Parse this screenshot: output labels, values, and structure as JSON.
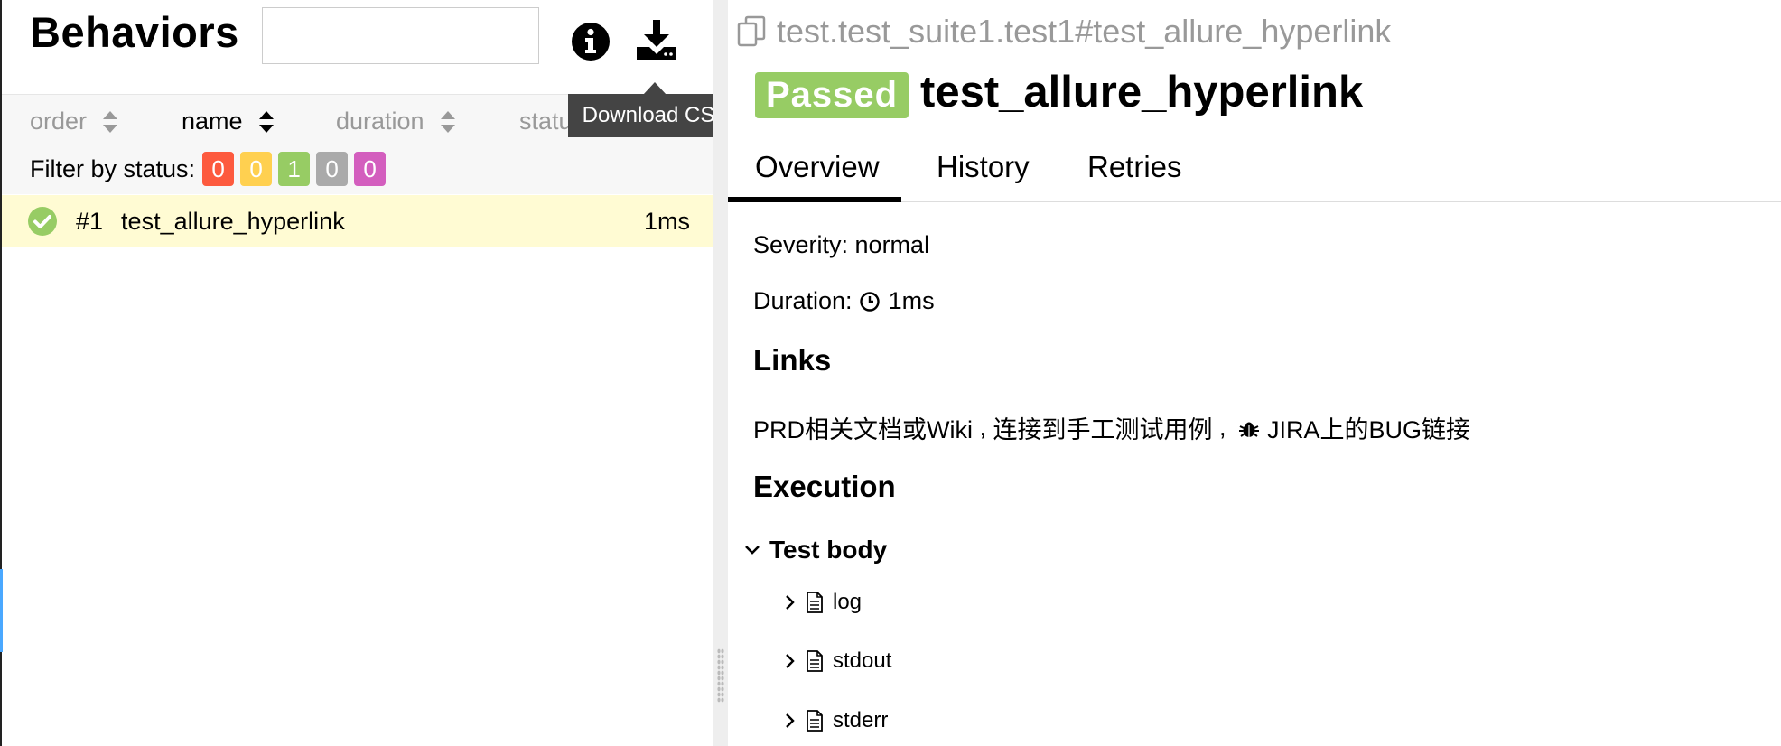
{
  "left": {
    "title": "Behaviors",
    "search": {
      "value": "",
      "placeholder": ""
    },
    "icons": {
      "info": "info-circle-icon",
      "download": "download-icon"
    },
    "tooltip": "Download CSV",
    "sort_columns": [
      {
        "label": "order",
        "active": false
      },
      {
        "label": "name",
        "active": true
      },
      {
        "label": "duration",
        "active": false
      },
      {
        "label": "status",
        "active": false
      }
    ],
    "filter": {
      "label": "Filter by status:",
      "chips": [
        {
          "count": "0",
          "status": "failed",
          "color": "#fd5a3e"
        },
        {
          "count": "0",
          "status": "broken",
          "color": "#ffd050"
        },
        {
          "count": "1",
          "status": "passed",
          "color": "#97cc64"
        },
        {
          "count": "0",
          "status": "skipped",
          "color": "#aaaaaa"
        },
        {
          "count": "0",
          "status": "unknown",
          "color": "#d35ebe"
        }
      ]
    },
    "tests": [
      {
        "order": "#1",
        "name": "test_allure_hyperlink",
        "duration": "1ms",
        "status": "passed"
      }
    ]
  },
  "right": {
    "breadcrumb": "test.test_suite1.test1#test_allure_hyperlink",
    "status_badge": "Passed",
    "title": "test_allure_hyperlink",
    "tabs": [
      {
        "label": "Overview",
        "active": true
      },
      {
        "label": "History",
        "active": false
      },
      {
        "label": "Retries",
        "active": false
      }
    ],
    "severity": "Severity: normal",
    "duration_label": "Duration:",
    "duration_value": "1ms",
    "links_heading": "Links",
    "links": {
      "link1": "PRD相关文档或Wiki",
      "sep1": " , ",
      "link2": "连接到手工测试用例",
      "sep2": " , ",
      "link3": "JIRA上的BUG链接"
    },
    "execution_heading": "Execution",
    "step": "Test body",
    "attachments": [
      "log",
      "stdout",
      "stderr"
    ]
  },
  "colors": {
    "passed": "#97cc64",
    "highlight_row": "#fffbd3",
    "tooltip_bg": "#444444"
  }
}
